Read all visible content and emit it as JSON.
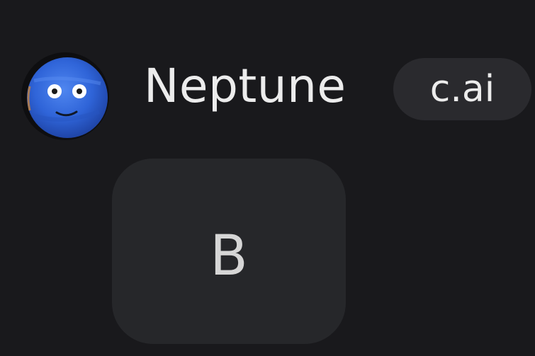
{
  "character": {
    "name": "Neptune",
    "avatar_icon": "neptune-planet-face-icon",
    "badge_label": "c.ai"
  },
  "message": {
    "text": "B"
  },
  "colors": {
    "background": "#19191c",
    "badge_background": "#2a2a2e",
    "bubble_background": "#26272a",
    "avatar_blue": "#2f64d8"
  }
}
